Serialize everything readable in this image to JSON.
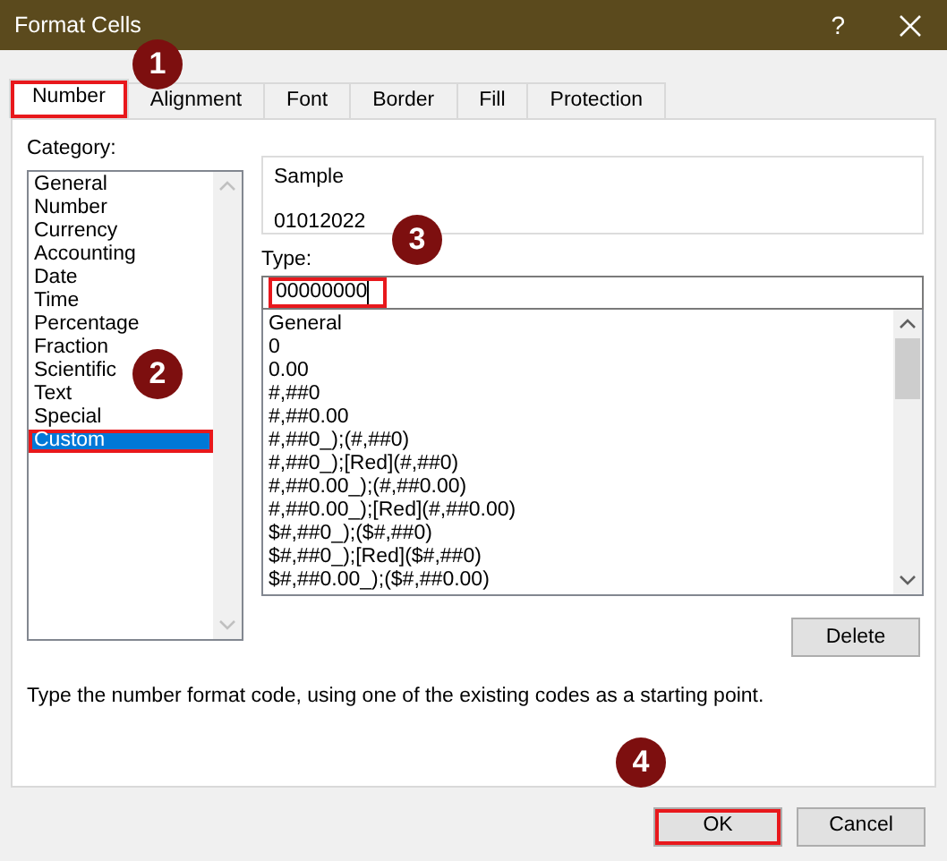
{
  "window": {
    "title": "Format Cells",
    "help": "?"
  },
  "tabs": [
    {
      "label": "Number",
      "selected": true,
      "highlighted": true
    },
    {
      "label": "Alignment",
      "selected": false,
      "highlighted": false
    },
    {
      "label": "Font",
      "selected": false,
      "highlighted": false
    },
    {
      "label": "Border",
      "selected": false,
      "highlighted": false
    },
    {
      "label": "Fill",
      "selected": false,
      "highlighted": false
    },
    {
      "label": "Protection",
      "selected": false,
      "highlighted": false
    }
  ],
  "category": {
    "label": "Category:",
    "items": [
      {
        "label": "General",
        "selected": false,
        "highlighted": false
      },
      {
        "label": "Number",
        "selected": false,
        "highlighted": false
      },
      {
        "label": "Currency",
        "selected": false,
        "highlighted": false
      },
      {
        "label": "Accounting",
        "selected": false,
        "highlighted": false
      },
      {
        "label": "Date",
        "selected": false,
        "highlighted": false
      },
      {
        "label": "Time",
        "selected": false,
        "highlighted": false
      },
      {
        "label": "Percentage",
        "selected": false,
        "highlighted": false
      },
      {
        "label": "Fraction",
        "selected": false,
        "highlighted": false
      },
      {
        "label": "Scientific",
        "selected": false,
        "highlighted": false
      },
      {
        "label": "Text",
        "selected": false,
        "highlighted": false
      },
      {
        "label": "Special",
        "selected": false,
        "highlighted": false
      },
      {
        "label": "Custom",
        "selected": true,
        "highlighted": true
      }
    ]
  },
  "sample": {
    "label": "Sample",
    "value": "01012022"
  },
  "type": {
    "label": "Type:",
    "value": "00000000",
    "highlighted": true,
    "formats": [
      "General",
      "0",
      "0.00",
      "#,##0",
      "#,##0.00",
      "#,##0_);(#,##0)",
      "#,##0_);[Red](#,##0)",
      "#,##0.00_);(#,##0.00)",
      "#,##0.00_);[Red](#,##0.00)",
      "$#,##0_);($#,##0)",
      "$#,##0_);[Red]($#,##0)",
      "$#,##0.00_);($#,##0.00)"
    ]
  },
  "delete_button": "Delete",
  "description": "Type the number format code, using one of the existing codes as a starting point.",
  "buttons": [
    {
      "label": "OK",
      "highlighted": true
    },
    {
      "label": "Cancel",
      "highlighted": false
    }
  ],
  "callouts": [
    {
      "number": "1"
    },
    {
      "number": "2"
    },
    {
      "number": "3"
    },
    {
      "number": "4"
    }
  ]
}
